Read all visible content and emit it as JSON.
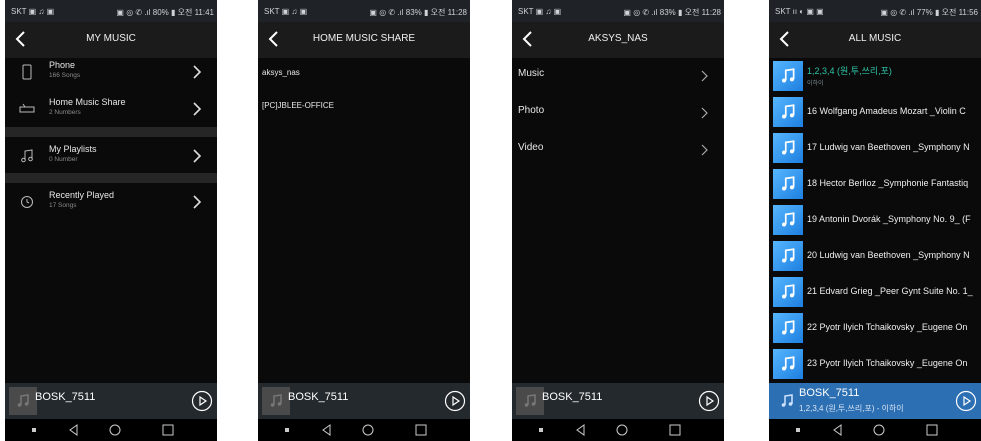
{
  "screens": [
    {
      "status_left": "SKT ▣ ♫ ▣",
      "status_right": "▣ ◎ ✆ .ıl 80% ▮ 오전 11:41",
      "title": "MY MUSIC",
      "items": [
        {
          "label": "Phone",
          "sub": "166 Songs",
          "icon": "phone-icon"
        },
        {
          "label": "Home Music Share",
          "sub": "2 Numbers",
          "icon": "router-icon"
        },
        {
          "label": "My Playlists",
          "sub": "0 Number",
          "icon": "music-note-icon"
        },
        {
          "label": "Recently Played",
          "sub": "17 Songs",
          "icon": "clock-icon"
        }
      ],
      "player": {
        "name": "BOSK_7511",
        "sub": ""
      }
    },
    {
      "status_left": "SKT ▣ ♫ ▣",
      "status_right": "▣ ◎ ✆ .ıl 83% ▮ 오전 11:28",
      "title": "HOME MUSIC SHARE",
      "items": [
        {
          "label": "aksys_nas"
        },
        {
          "label": "[PC]JBLEE-OFFICE"
        }
      ],
      "player": {
        "name": "BOSK_7511",
        "sub": ""
      }
    },
    {
      "status_left": "SKT ▣ ♫ ▣",
      "status_right": "▣ ◎ ✆ .ıl 83% ▮ 오전 11:28",
      "title": "AKSYS_NAS",
      "items": [
        {
          "label": "Music"
        },
        {
          "label": "Photo"
        },
        {
          "label": "Video"
        }
      ],
      "player": {
        "name": "BOSK_7511",
        "sub": ""
      }
    },
    {
      "status_left": "SKT ıı ◐ ▣ ▣",
      "status_right": "▣ ◎ ✆ .ıl 77% ▮ 오전 11:56",
      "title": "ALL MUSIC",
      "songs": [
        {
          "title": "1,2,3,4 (원,투,쓰리,포)",
          "artist": "이하이"
        },
        {
          "title": "16 Wolfgang Amadeus Mozart _Violin C",
          "artist": ""
        },
        {
          "title": "17 Ludwig van Beethoven _Symphony N",
          "artist": ""
        },
        {
          "title": "18 Hector Berlioz _Symphonie Fantastiq",
          "artist": ""
        },
        {
          "title": "19 Antonin Dvorák _Symphony No. 9_ (F",
          "artist": ""
        },
        {
          "title": "20 Ludwig van Beethoven _Symphony N",
          "artist": ""
        },
        {
          "title": "21 Edvard Grieg _Peer Gynt Suite No. 1_",
          "artist": ""
        },
        {
          "title": "22 Pyotr Ilyich Tchaikovsky _Eugene On",
          "artist": ""
        },
        {
          "title": "23 Pyotr Ilyich Tchaikovsky _Eugene On",
          "artist": ""
        }
      ],
      "player": {
        "name": "BOSK_7511",
        "sub": "1,2,3,4 (원,투,쓰리,포) - 이하이"
      }
    }
  ],
  "colors": {
    "accent_teal": "#2ec4a6",
    "thumb_blue": "#1d7fe0",
    "player_blue": "#2d6fb3"
  }
}
